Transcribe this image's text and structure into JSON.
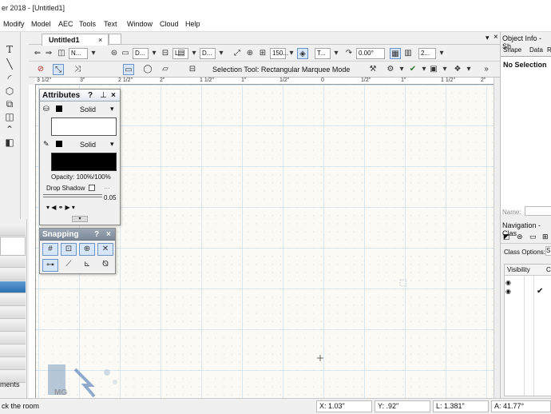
{
  "window": {
    "title": "er 2018 - [Untitled1]"
  },
  "menu": [
    "Modify",
    "Model",
    "AEC",
    "Tools",
    "Text",
    "Window",
    "Cloud",
    "Help"
  ],
  "document_tab": {
    "label": "Untitled1",
    "close": "×"
  },
  "view_bar": {
    "dd1": "N...",
    "dd2": "D...",
    "dd3": "L...",
    "dd4": "D...",
    "zoom": "150...",
    "text_style": "T...",
    "rotation": "0.00°",
    "dd5": "2..."
  },
  "mode_bar": {
    "selection_text": "Selection Tool: Rectangular Marquee Mode"
  },
  "ruler": {
    "labels": [
      "3 1/2\"",
      "3\"",
      "2 1/2\"",
      "2\"",
      "1 1/2\"",
      "1\"",
      "1/2\"",
      "0",
      "1/2\"",
      "1\"",
      "1 1/2\"",
      "2\""
    ]
  },
  "attributes": {
    "title": "Attributes",
    "help": "?",
    "close": "×",
    "fill_style": "Solid",
    "pen_style": "Solid",
    "opacity_text": "Opacity: 100%/100%",
    "drop_shadow": "Drop Shadow",
    "line_thickness": "0.05",
    "fill_color": "#ffffff",
    "pen_color": "#000000"
  },
  "snapping": {
    "title": "Snapping",
    "help": "?",
    "close": "×"
  },
  "object_info": {
    "title": "Object Info - Sh",
    "tabs": [
      "Shape",
      "Data",
      "R"
    ],
    "selection": "No Selection",
    "name_label": "Name:"
  },
  "navigation": {
    "title": "Navigation - Clas",
    "class_options_label": "Class Options:",
    "class_options_value": "S",
    "visibility_col": "Visibility",
    "col2": "C"
  },
  "left_palette": {
    "label": "ments"
  },
  "status": {
    "hint": "ck the room",
    "x": "X: 1.03\"",
    "y": "Y: .92\"",
    "l": "L: 1.381\"",
    "a": "A: 41.77°"
  },
  "watermark": "MG"
}
